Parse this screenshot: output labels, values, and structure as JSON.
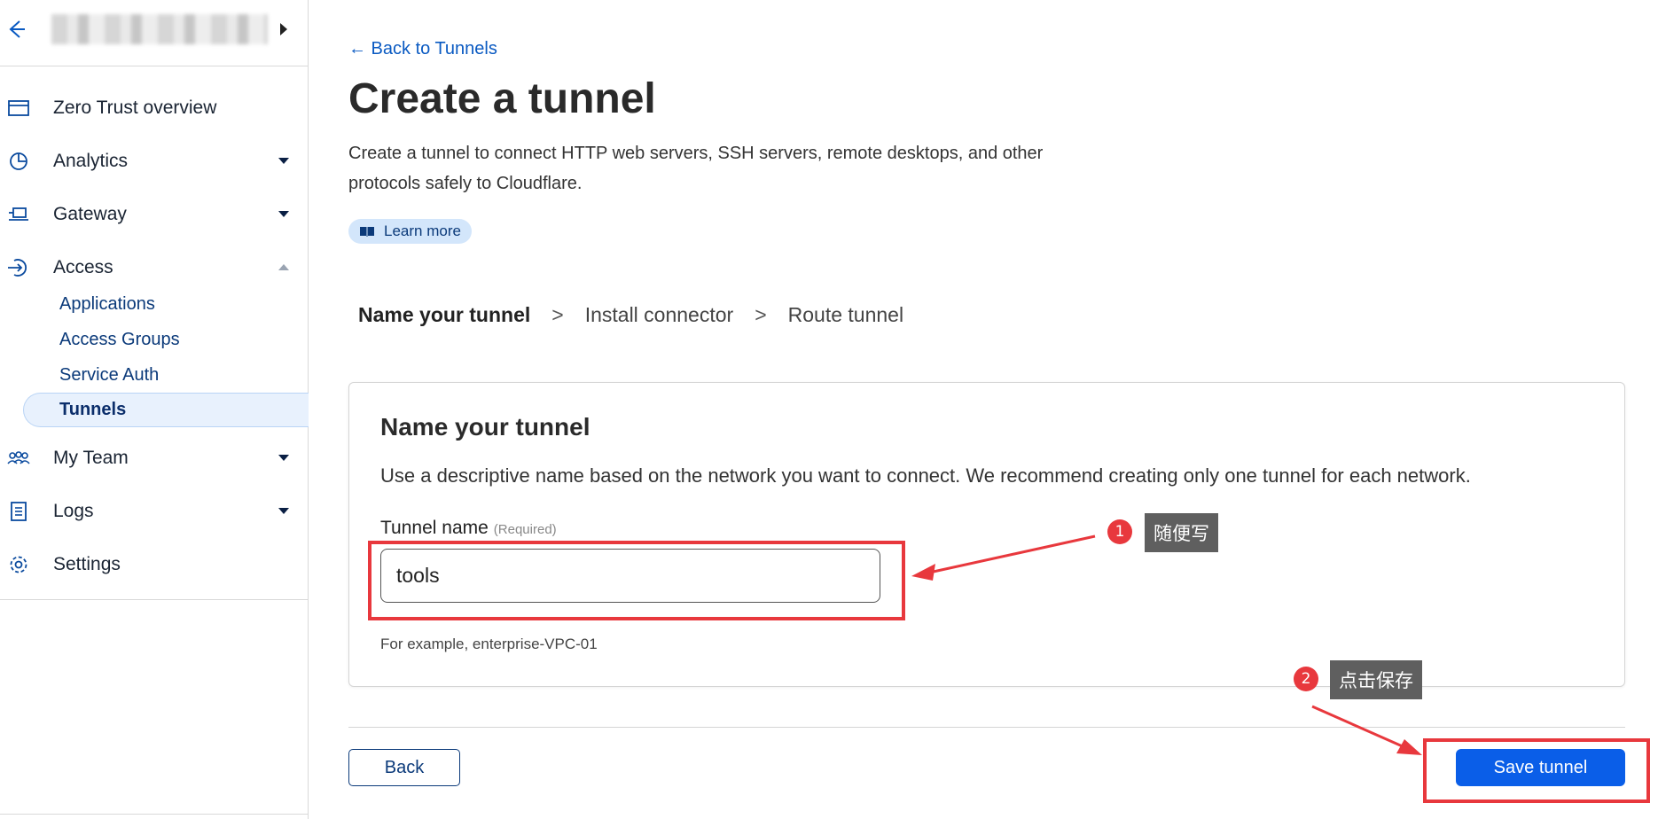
{
  "sidebar": {
    "account_caret": "caret-right-icon",
    "items": [
      {
        "label": "Zero Trust overview",
        "icon": "browser-window-icon",
        "has_caret": false
      },
      {
        "label": "Analytics",
        "icon": "pie-chart-icon",
        "has_caret": true
      },
      {
        "label": "Gateway",
        "icon": "gateway-icon",
        "has_caret": true
      },
      {
        "label": "Access",
        "icon": "access-icon",
        "has_caret": true,
        "expanded": true
      },
      {
        "label": "My Team",
        "icon": "team-icon",
        "has_caret": true
      },
      {
        "label": "Logs",
        "icon": "logs-icon",
        "has_caret": true
      },
      {
        "label": "Settings",
        "icon": "gear-icon",
        "has_caret": false
      }
    ],
    "access_sub_items": [
      {
        "label": "Applications"
      },
      {
        "label": "Access Groups"
      },
      {
        "label": "Service Auth"
      },
      {
        "label": "Tunnels",
        "active": true
      }
    ]
  },
  "main": {
    "back_link": "← Back to Tunnels",
    "title": "Create a tunnel",
    "description": "Create a tunnel to connect HTTP web servers, SSH servers, remote desktops, and other protocols safely to Cloudflare.",
    "learn_more": "Learn more",
    "steps": {
      "step1": "Name your tunnel",
      "step2": "Install connector",
      "step3": "Route tunnel",
      "separator": ">"
    },
    "card": {
      "title": "Name your tunnel",
      "description": "Use a descriptive name based on the network you want to connect. We recommend creating only one tunnel for each network.",
      "field_label": "Tunnel name",
      "field_required": "(Required)",
      "field_value": "tools",
      "field_hint": "For example, enterprise-VPC-01"
    },
    "back_button": "Back",
    "save_button": "Save tunnel"
  },
  "annotations": {
    "badge1": "1",
    "note1": "随便写",
    "badge2": "2",
    "note2": "点击保存",
    "color": "#e8383d"
  },
  "colors": {
    "accent": "#0a5ee8",
    "link": "#0a5ac2",
    "nav_active_bg": "#e8f1fd"
  }
}
